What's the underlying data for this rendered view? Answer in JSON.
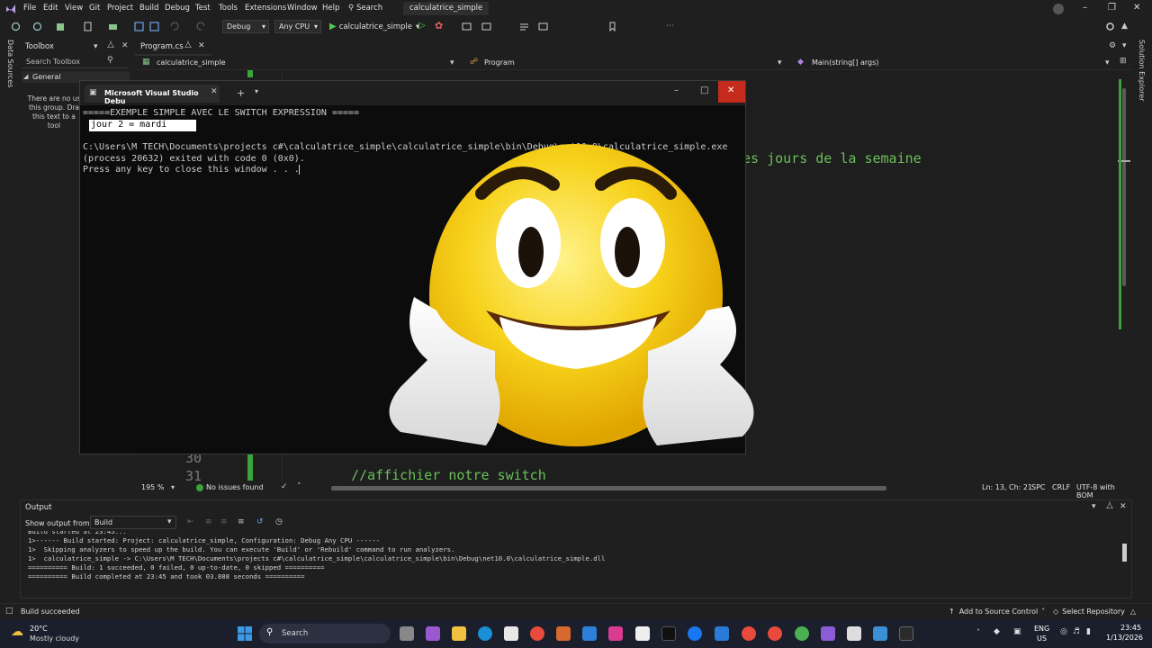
{
  "menubar": {
    "items": [
      "File",
      "Edit",
      "View",
      "Git",
      "Project",
      "Build",
      "Debug",
      "Test",
      "Tools",
      "Extensions",
      "Window",
      "Help"
    ],
    "search_label": "Search",
    "solution_title": "calculatrice_simple"
  },
  "toolbar": {
    "configuration": "Debug",
    "platform": "Any CPU",
    "run_target": "calculatrice_simple"
  },
  "left_strip": {
    "data_sources": "Data Sources"
  },
  "right_strip": {
    "solution_explorer": "Solution Explorer"
  },
  "toolbox": {
    "title": "Toolbox",
    "search_placeholder": "Search Toolbox",
    "group": "General",
    "empty_text_lines": [
      "There are no us",
      "this group. Dra",
      "this text to a",
      "tool"
    ]
  },
  "editor": {
    "tab_label": "Program.cs",
    "nav_project": "calculatrice_simple",
    "nav_class": "Program",
    "nav_member": "Main(string[] args)",
    "code_fragment_right": "es jours de la semaine",
    "line_numbers": [
      "30",
      "31"
    ],
    "comment_line": "//affichier notre switch",
    "zoom": "195 %",
    "issues": "No issues found",
    "position": "Ln: 13, Ch: 21",
    "whitespace": "SPC",
    "line_ending": "CRLF",
    "encoding": "UTF-8 with BOM"
  },
  "console": {
    "title": "Microsoft Visual Studio Debu",
    "lines": [
      "=====EXEMPLE SIMPLE AVEC LE SWITCH EXPRESSION =====",
      "jour 2 = mardi",
      "",
      "C:\\Users\\M TECH\\Documents\\projects c#\\calculatrice_simple\\calculatrice_simple\\bin\\Debug\\net10.0\\calculatrice_simple.exe",
      "(process 20632) exited with code 0 (0x0).",
      "Press any key to close this window . . ."
    ]
  },
  "output": {
    "title": "Output",
    "show_from_label": "Show output from:",
    "source": "Build",
    "lines": [
      "Build started at 23:45...",
      "1>------ Build started: Project: calculatrice_simple, Configuration: Debug Any CPU ------",
      "1>  Skipping analyzers to speed up the build. You can execute 'Build' or 'Rebuild' command to run analyzers.",
      "1>  calculatrice_simple -> C:\\Users\\M TECH\\Documents\\projects c#\\calculatrice_simple\\calculatrice_simple\\bin\\Debug\\net10.0\\calculatrice_simple.dll",
      "========== Build: 1 succeeded, 0 failed, 0 up-to-date, 0 skipped ==========",
      "========== Build completed at 23:45 and took 03.888 seconds =========="
    ]
  },
  "statusbar": {
    "build_status": "Build succeeded",
    "source_control": "Add to Source Control",
    "repository": "Select Repository"
  },
  "taskbar": {
    "weather_temp": "20°C",
    "weather_desc": "Mostly cloudy",
    "search_label": "Search",
    "lang_1": "ENG",
    "lang_2": "US",
    "time": "23:45",
    "date": "1/13/2026"
  },
  "colors": {
    "accent_green": "#4ec94e",
    "close_red": "#c42b1c",
    "vs_purple": "#8a5cd6"
  }
}
